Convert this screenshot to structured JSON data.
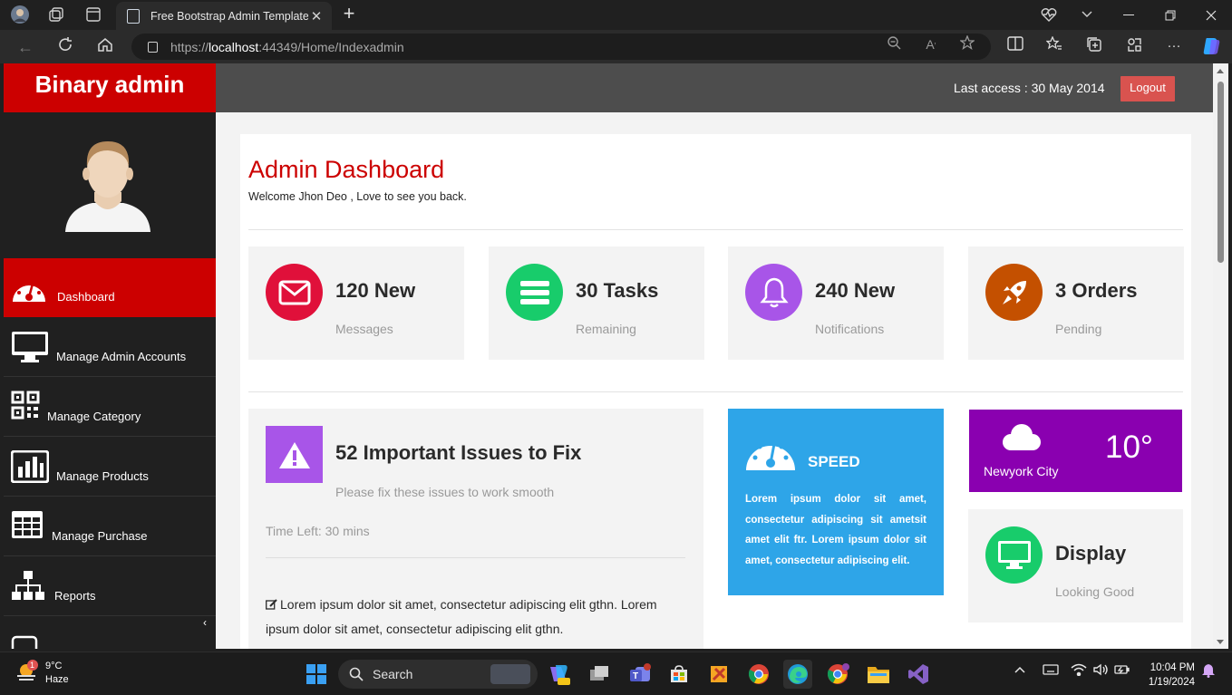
{
  "browser": {
    "tab_title": "Free Bootstrap Admin Template :",
    "url_prefix": "https://",
    "url_host": "localhost",
    "url_rest": ":44349/Home/Indexadmin"
  },
  "header": {
    "brand": "Binary admin",
    "last_access": "Last access : 30 May 2014",
    "logout_label": "Logout"
  },
  "sidebar": {
    "items": [
      {
        "label": "Dashboard",
        "icon": "dashboard-gauge-icon"
      },
      {
        "label": "Manage Admin Accounts",
        "icon": "desktop-icon"
      },
      {
        "label": "Manage Category",
        "icon": "qrcode-icon"
      },
      {
        "label": "Manage Products",
        "icon": "bar-chart-icon"
      },
      {
        "label": "Manage Purchase",
        "icon": "table-icon"
      },
      {
        "label": "Reports",
        "icon": "sitemap-icon"
      }
    ]
  },
  "main": {
    "title": "Admin Dashboard",
    "welcome": "Welcome Jhon Deo , Love to see you back.",
    "stats": [
      {
        "value": "120 New",
        "caption": "Messages",
        "color": "#e0103a",
        "icon": "envelope-icon"
      },
      {
        "value": "30 Tasks",
        "caption": "Remaining",
        "color": "#18cc6b",
        "icon": "bars-icon"
      },
      {
        "value": "240 New",
        "caption": "Notifications",
        "color": "#a855e8",
        "icon": "bell-icon"
      },
      {
        "value": "3 Orders",
        "caption": "Pending",
        "color": "#c45000",
        "icon": "rocket-icon"
      }
    ],
    "issues": {
      "title": "52 Important Issues to Fix",
      "subtitle": "Please fix these issues to work smooth",
      "time_left": "Time Left: 30 mins",
      "body": "Lorem ipsum dolor sit amet, consectetur adipiscing elit gthn. Lorem ipsum dolor sit amet, consectetur adipiscing elit gthn."
    },
    "speed": {
      "label": "SPEED",
      "text": "Lorem ipsum dolor sit amet, consectetur adipiscing sit ametsit amet elit ftr. Lorem ipsum dolor sit amet, consectetur adipiscing elit."
    },
    "weather": {
      "city": "Newyork City",
      "temp": "10°"
    },
    "display": {
      "title": "Display",
      "subtitle": "Looking Good"
    }
  },
  "taskbar": {
    "temp": "9°C",
    "condition": "Haze",
    "search_label": "Search",
    "time": "10:04 PM",
    "date": "1/19/2024",
    "weather_badge": "1"
  }
}
